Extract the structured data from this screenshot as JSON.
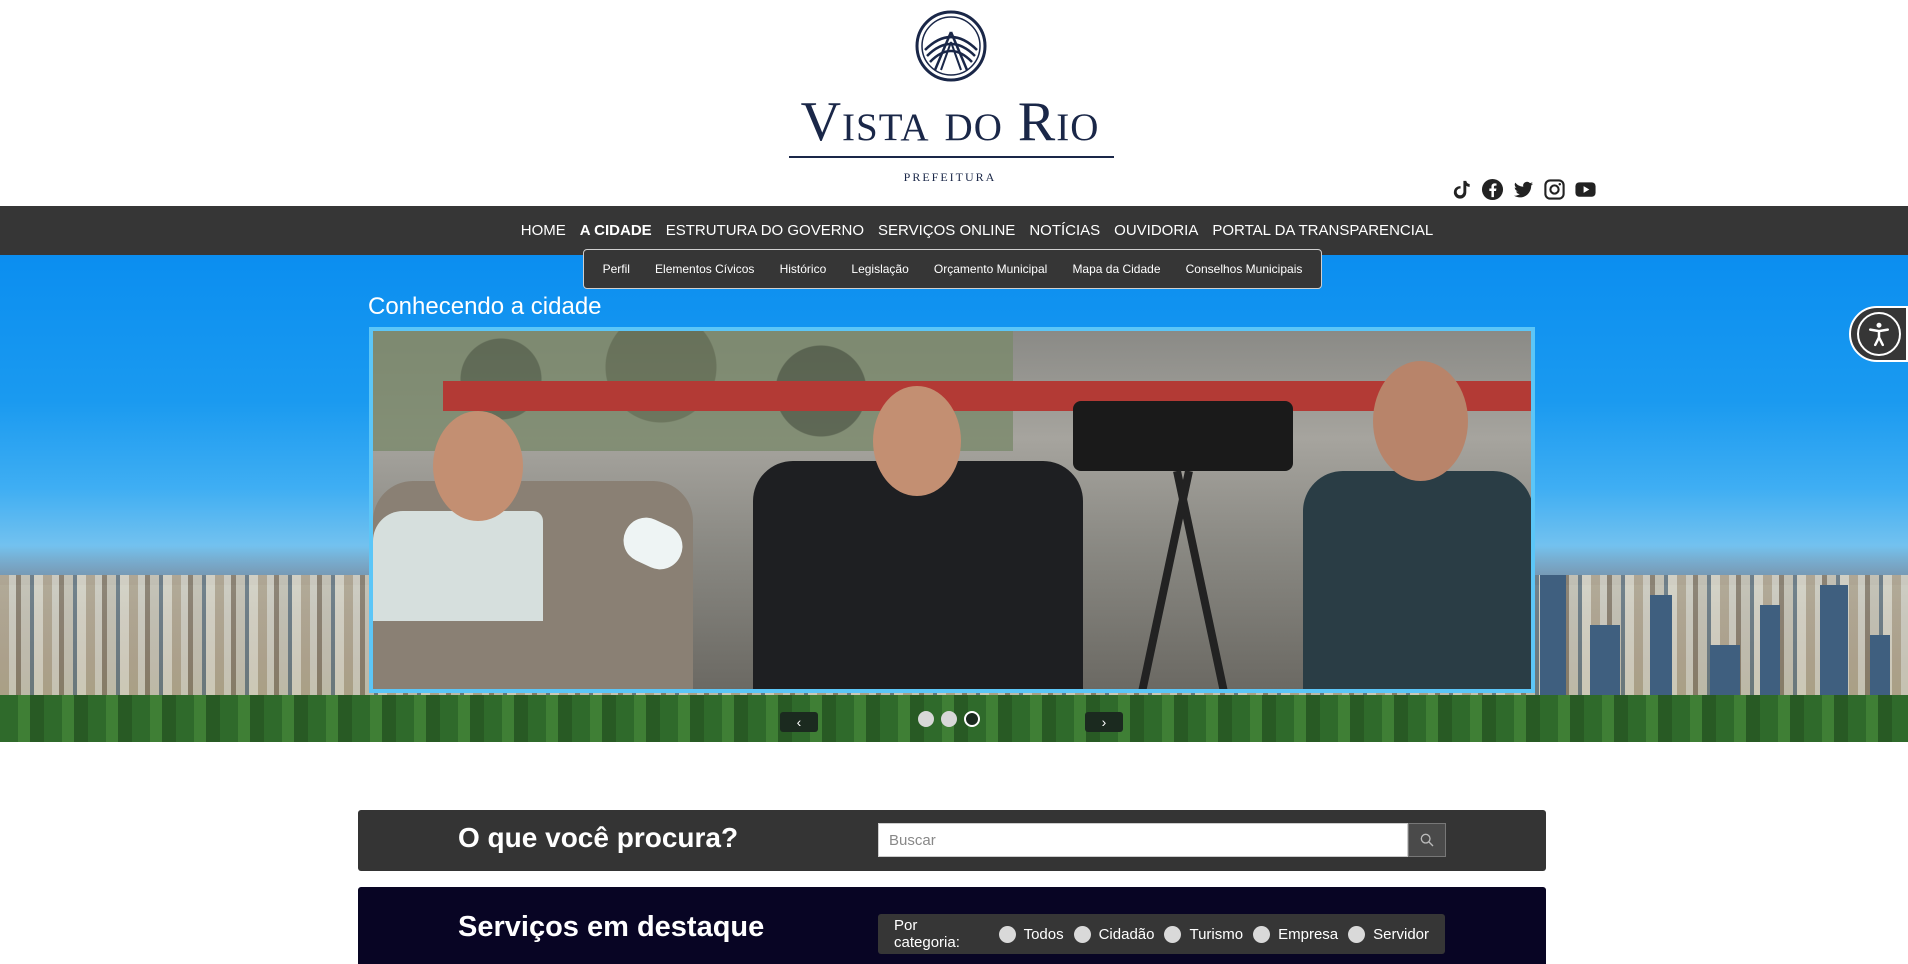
{
  "brand": {
    "name": "Vista do Rio",
    "subtitle": "PREFEITURA",
    "color": "#1a2748"
  },
  "social": [
    {
      "name": "tiktok-icon"
    },
    {
      "name": "facebook-icon"
    },
    {
      "name": "twitter-icon"
    },
    {
      "name": "instagram-icon"
    },
    {
      "name": "youtube-icon"
    }
  ],
  "nav": {
    "items": [
      {
        "label": "HOME"
      },
      {
        "label": "A CIDADE",
        "active": true
      },
      {
        "label": "ESTRUTURA DO GOVERNO"
      },
      {
        "label": "SERVIÇOS ONLINE"
      },
      {
        "label": "NOTÍCIAS"
      },
      {
        "label": "OUVIDORIA"
      },
      {
        "label": "PORTAL DA TRANSPARENCIAL"
      }
    ]
  },
  "submenu": {
    "items": [
      {
        "label": "Perfil"
      },
      {
        "label": "Elementos Cívicos"
      },
      {
        "label": "Histórico"
      },
      {
        "label": "Legislação"
      },
      {
        "label": "Orçamento Municipal"
      },
      {
        "label": "Mapa da Cidade"
      },
      {
        "label": "Conselhos Municipais"
      }
    ]
  },
  "hero": {
    "title": "Conhecendo a cidade",
    "prev": "‹",
    "next": "›",
    "slides_total": 3,
    "active_slide": 3
  },
  "search": {
    "title": "O que você procura?",
    "placeholder": "Buscar"
  },
  "services": {
    "title": "Serviços em destaque",
    "filter_label": "Por categoria:",
    "options": [
      "Todos",
      "Cidadão",
      "Turismo",
      "Empresa",
      "Servidor"
    ]
  },
  "colors": {
    "nav_bg": "#363636",
    "services_bg": "#080524",
    "slide_border": "#5cc6f7"
  }
}
